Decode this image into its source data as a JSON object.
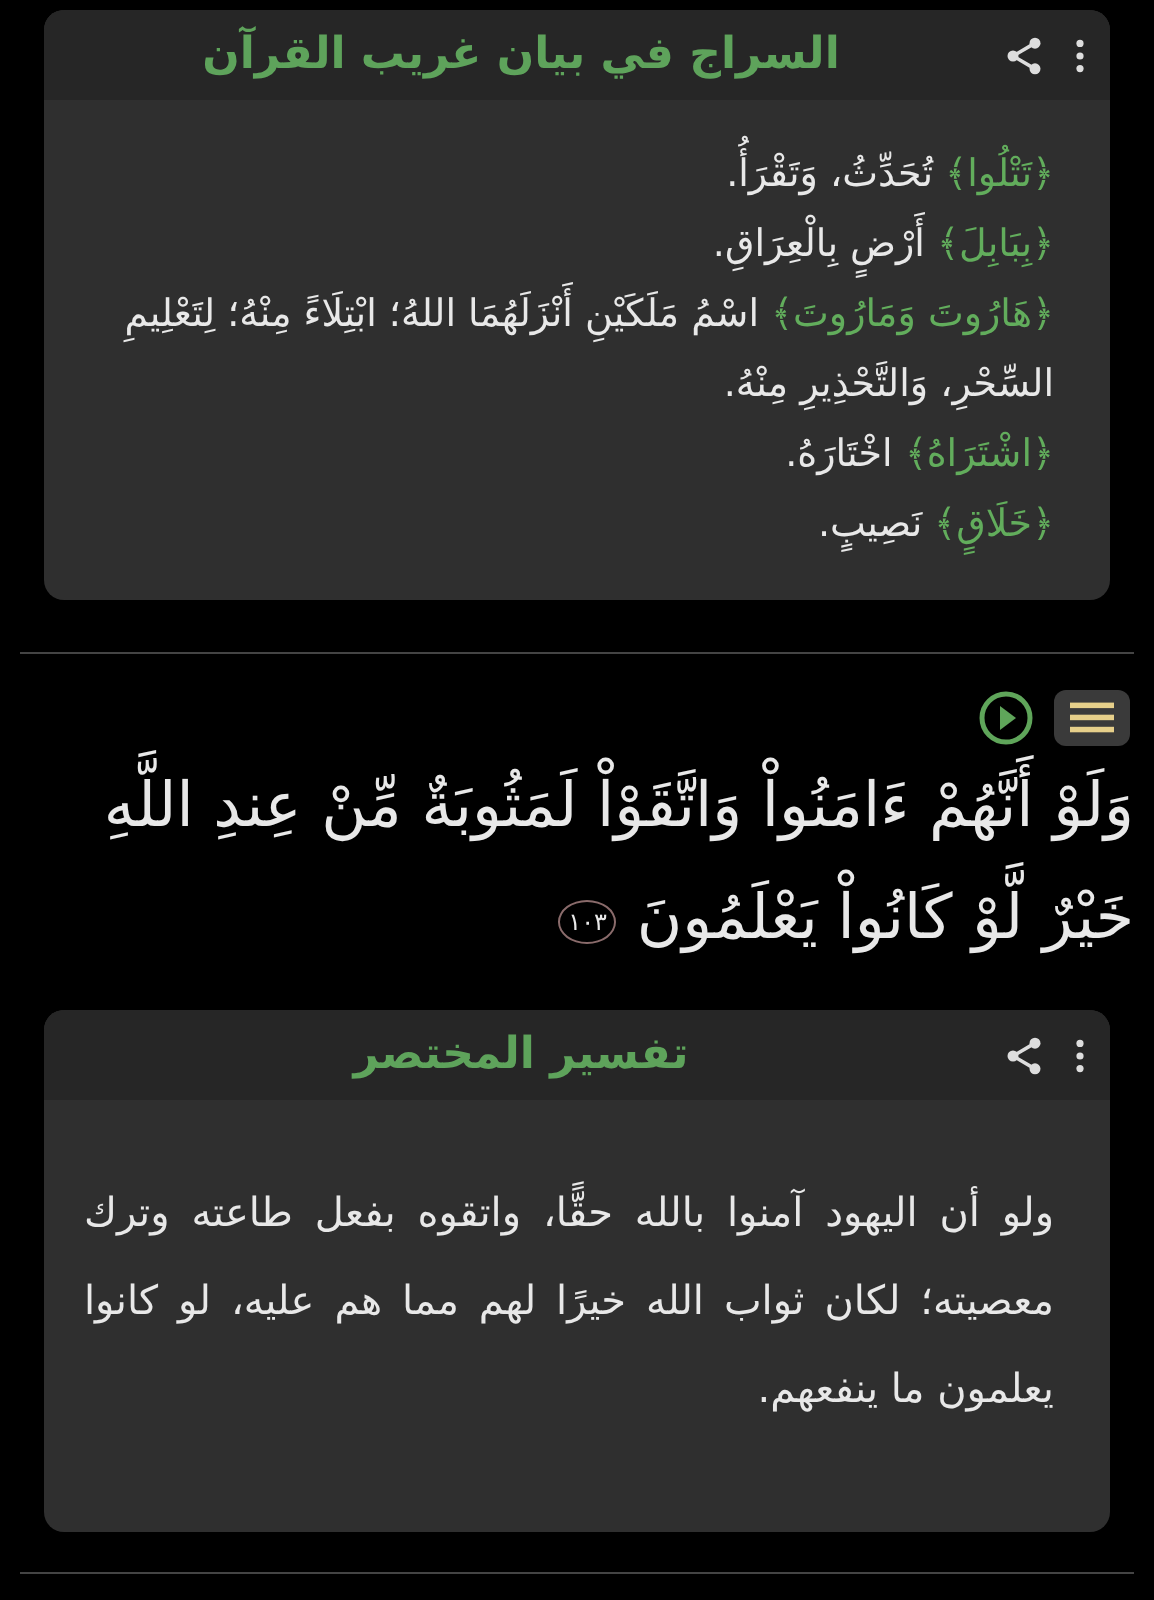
{
  "sections": [
    {
      "kind": "glossary",
      "title": "السراج في بيان غريب القرآن",
      "entries": [
        {
          "word": "﴿تَتْلُوا﴾",
          "meaning": "تُحَدِّثُ، وَتَقْرَأُ."
        },
        {
          "word": "﴿بِبَابِلَ﴾",
          "meaning": "أَرْضٍ بِالْعِرَاقِ."
        },
        {
          "word": "﴿هَارُوتَ وَمَارُوتَ﴾",
          "meaning": "اسْمُ مَلَكَيْنِ أَنْزَلَهُمَا اللهُ؛ ابْتِلَاءً مِنْهُ؛ لِتَعْلِيمِ السِّحْرِ، وَالتَّحْذِيرِ مِنْهُ."
        },
        {
          "word": "﴿اشْتَرَاهُ﴾",
          "meaning": "اخْتَارَهُ."
        },
        {
          "word": "﴿خَلَاقٍ﴾",
          "meaning": "نَصِيبٍ."
        }
      ]
    },
    {
      "kind": "verse",
      "text": "وَلَوْ أَنَّهُمْ ءَامَنُواْ وَاتَّقَوْاْ لَمَثُوبَةٌ مِّنْ عِندِ اللَّهِ خَيْرٌ لَّوْ كَانُواْ يَعْلَمُونَ",
      "number": "١٠٣"
    },
    {
      "kind": "text",
      "title": "تفسير المختصر",
      "body": "ولو أن اليهود آمنوا بالله حقًّا، واتقوه بفعل طاعته وترك معصيته؛ لكان ثواب الله خيرًا لهم مما هم عليه، لو كانوا يعلمون ما ينفعهم."
    }
  ]
}
